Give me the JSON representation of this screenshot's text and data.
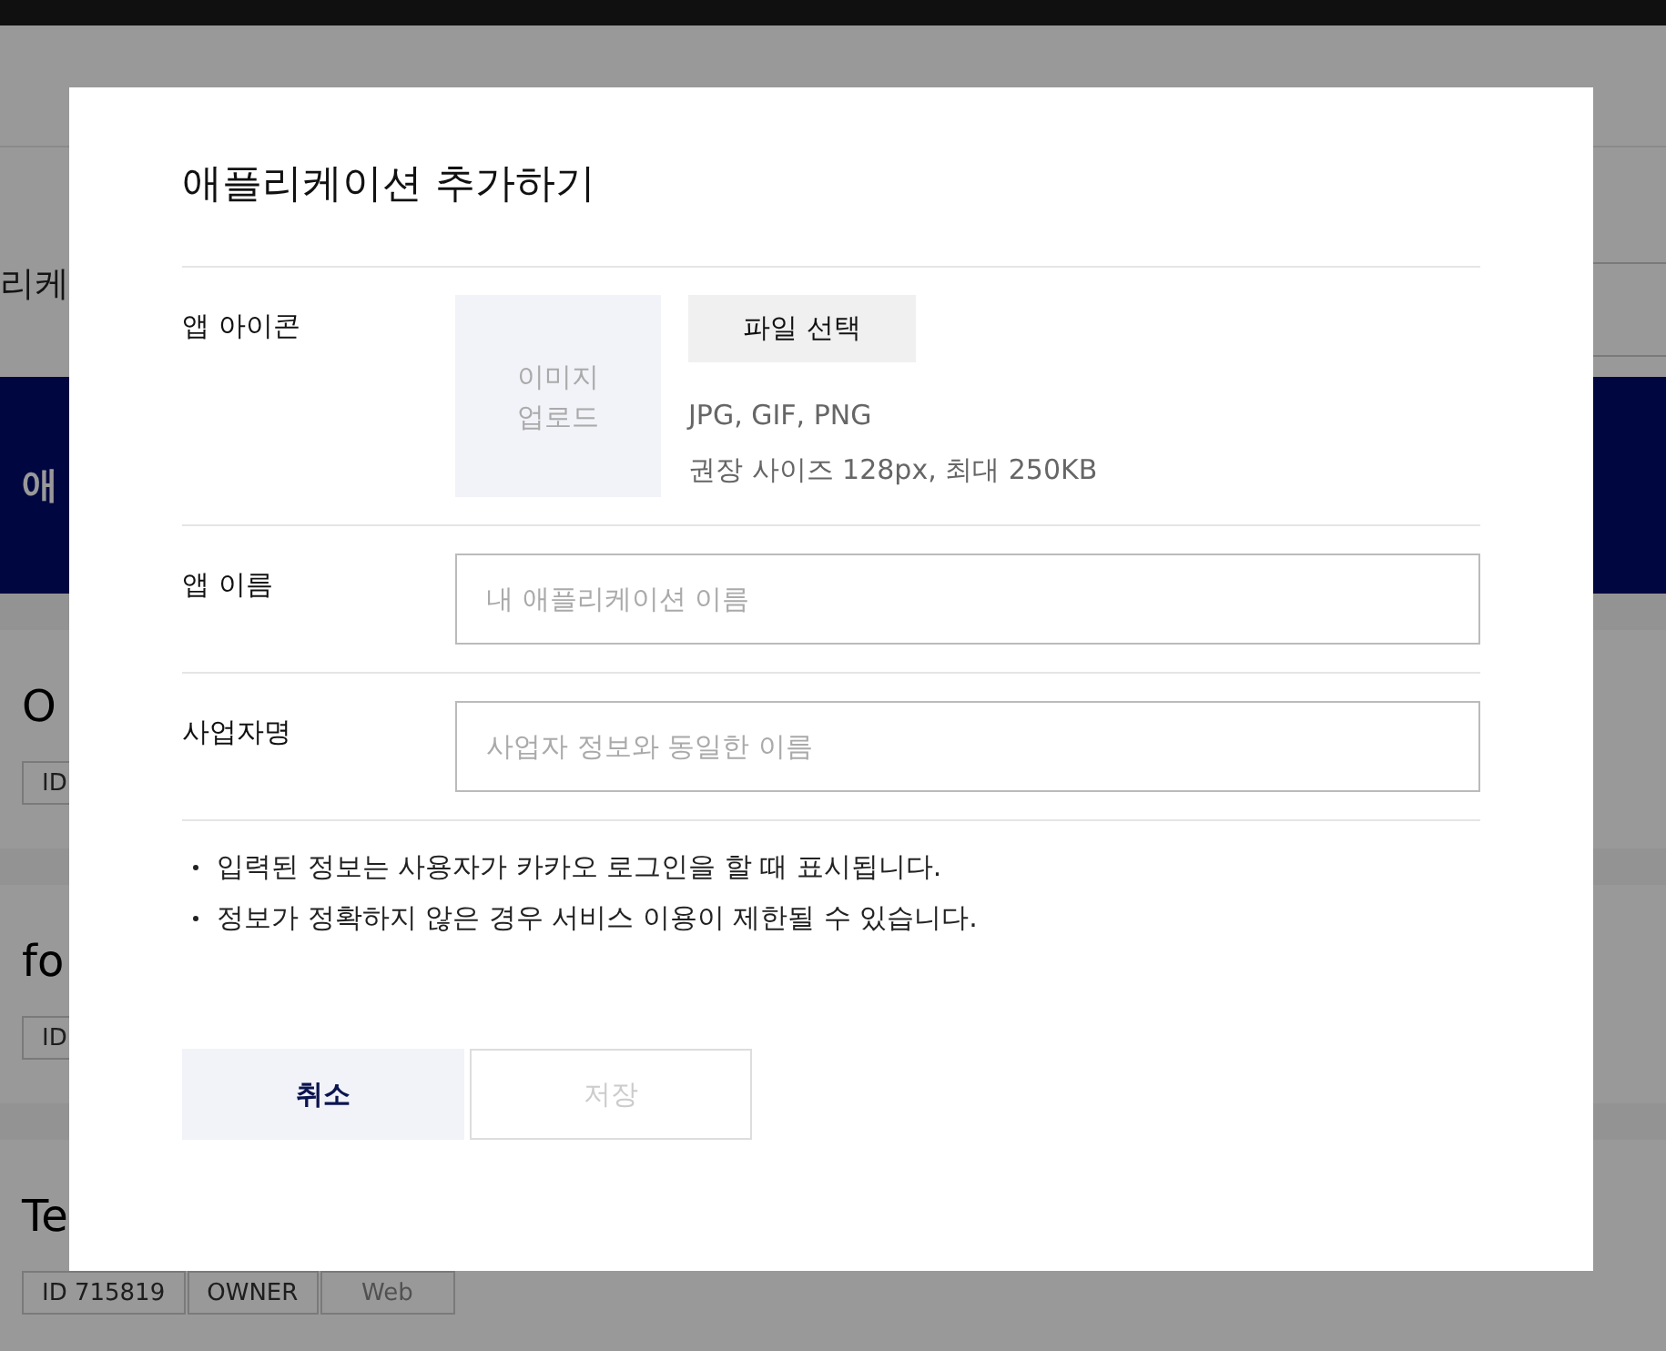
{
  "background": {
    "header_text": "리케",
    "banner_text": "애",
    "apps": [
      {
        "name": "O",
        "tags": [
          {
            "label": "ID",
            "muted": false
          }
        ]
      },
      {
        "name": "fo",
        "tags": [
          {
            "label": "ID",
            "muted": false
          }
        ]
      },
      {
        "name": "Te",
        "tags": [
          {
            "label": "ID 715819",
            "muted": false
          },
          {
            "label": "OWNER",
            "muted": false
          },
          {
            "label": "Web",
            "muted": true
          }
        ]
      }
    ]
  },
  "dialog": {
    "title": "애플리케이션 추가하기",
    "icon_field": {
      "label": "앱 아이콘",
      "upload_lines": [
        "이미지",
        "업로드"
      ],
      "button": "파일 선택",
      "hints": [
        "JPG, GIF, PNG",
        "권장 사이즈 128px, 최대 250KB"
      ]
    },
    "text_fields": [
      {
        "label": "앱 이름",
        "placeholder": "내 애플리케이션 이름"
      },
      {
        "label": "사업자명",
        "placeholder": "사업자 정보와 동일한 이름"
      }
    ],
    "notes": [
      "입력된 정보는 사용자가 카카오 로그인을 할 때 표시됩니다.",
      "정보가 정확하지 않은 경우 서비스 이용이 제한될 수 있습니다."
    ],
    "buttons": [
      {
        "label": "취소",
        "disabled": false
      },
      {
        "label": "저장",
        "disabled": true
      }
    ]
  }
}
